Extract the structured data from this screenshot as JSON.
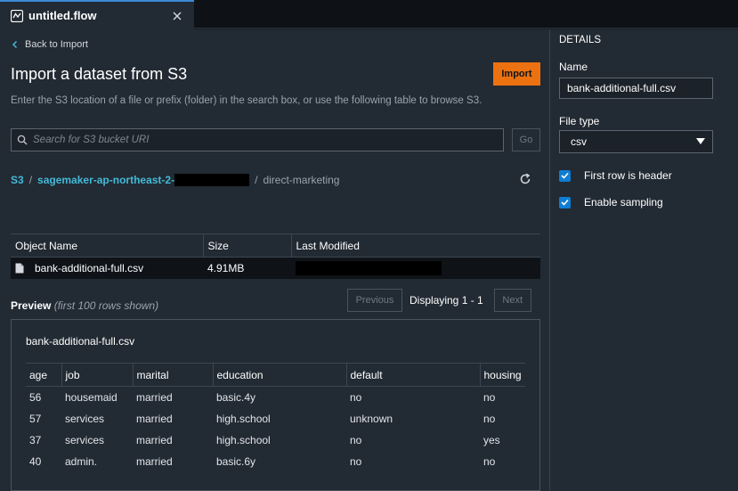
{
  "tab": {
    "title": "untitled.flow"
  },
  "main": {
    "back_label": "Back to Import",
    "title": "Import a dataset from S3",
    "import_label": "Import",
    "description": "Enter the S3 location of a file or prefix (folder) in the search box, or use the following table to browse S3.",
    "search": {
      "placeholder": "Search for S3 bucket URI",
      "value": "",
      "go_label": "Go"
    },
    "breadcrumb": {
      "root": "S3",
      "bucket": "sagemaker-ap-northeast-2-",
      "folder": "direct-marketing"
    },
    "objects_table": {
      "headers": [
        "Object Name",
        "Size",
        "Last Modified"
      ],
      "rows": [
        {
          "name": "bank-additional-full.csv",
          "size": "4.91MB"
        }
      ]
    },
    "pager": {
      "previous": "Previous",
      "info": "Displaying 1 - 1",
      "next": "Next"
    },
    "preview": {
      "label": "Preview",
      "note": "(first 100 rows shown)",
      "file_name": "bank-additional-full.csv",
      "headers": [
        "age",
        "job",
        "marital",
        "education",
        "default",
        "housing"
      ],
      "rows": [
        [
          "56",
          "housemaid",
          "married",
          "basic.4y",
          "no",
          "no"
        ],
        [
          "57",
          "services",
          "married",
          "high.school",
          "unknown",
          "no"
        ],
        [
          "37",
          "services",
          "married",
          "high.school",
          "no",
          "yes"
        ],
        [
          "40",
          "admin.",
          "married",
          "basic.6y",
          "no",
          "no"
        ]
      ]
    }
  },
  "details": {
    "heading": "DETAILS",
    "name_label": "Name",
    "name_value": "bank-additional-full.csv",
    "file_type_label": "File type",
    "file_type_value": "csv",
    "first_row_header_label": "First row is header",
    "first_row_header_checked": true,
    "enable_sampling_label": "Enable sampling",
    "enable_sampling_checked": true
  },
  "colors": {
    "accent_orange": "#ec7211",
    "link_blue": "#44b9d6",
    "checkbox_blue": "#0f7dd4",
    "panel_bg": "#222a33"
  }
}
